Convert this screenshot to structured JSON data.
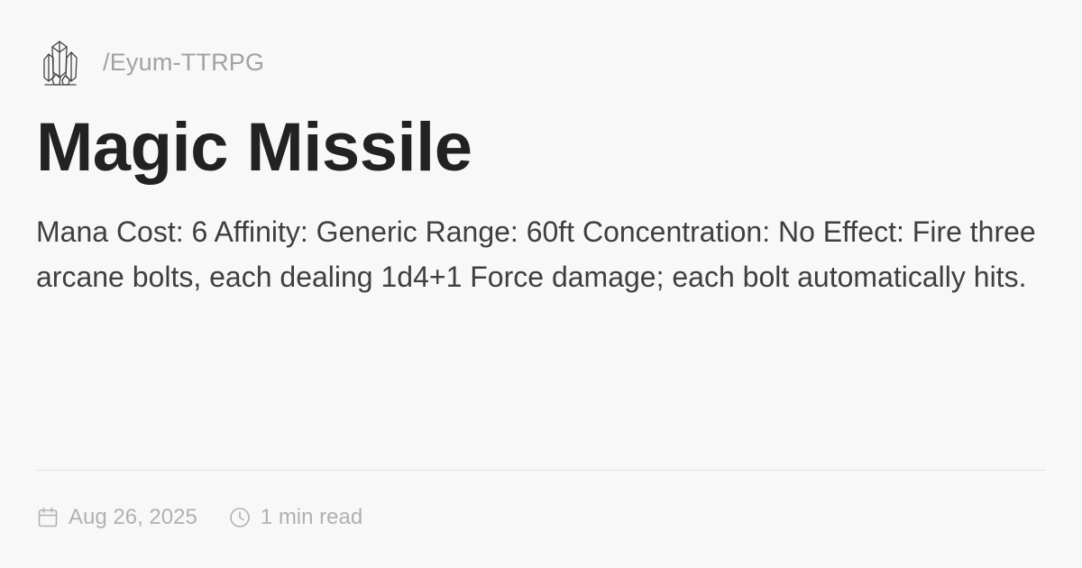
{
  "header": {
    "logo_icon": "crystal-cluster-icon",
    "site_path": "/Eyum-TTRPG"
  },
  "article": {
    "title": "Magic Missile",
    "description": "Mana Cost: 6 Affinity: Generic Range: 60ft Concentration: No Effect: Fire three arcane bolts, each dealing 1d4+1 Force damage; each bolt automatically hits."
  },
  "meta": {
    "date_icon": "calendar-icon",
    "date": "Aug 26, 2025",
    "read_time_icon": "clock-icon",
    "read_time": "1 min read"
  },
  "colors": {
    "background": "#f9f8f9",
    "title": "#222222",
    "body_text": "#3f3f3f",
    "muted_text": "#a2a2a2",
    "divider": "#e2e2e2"
  }
}
